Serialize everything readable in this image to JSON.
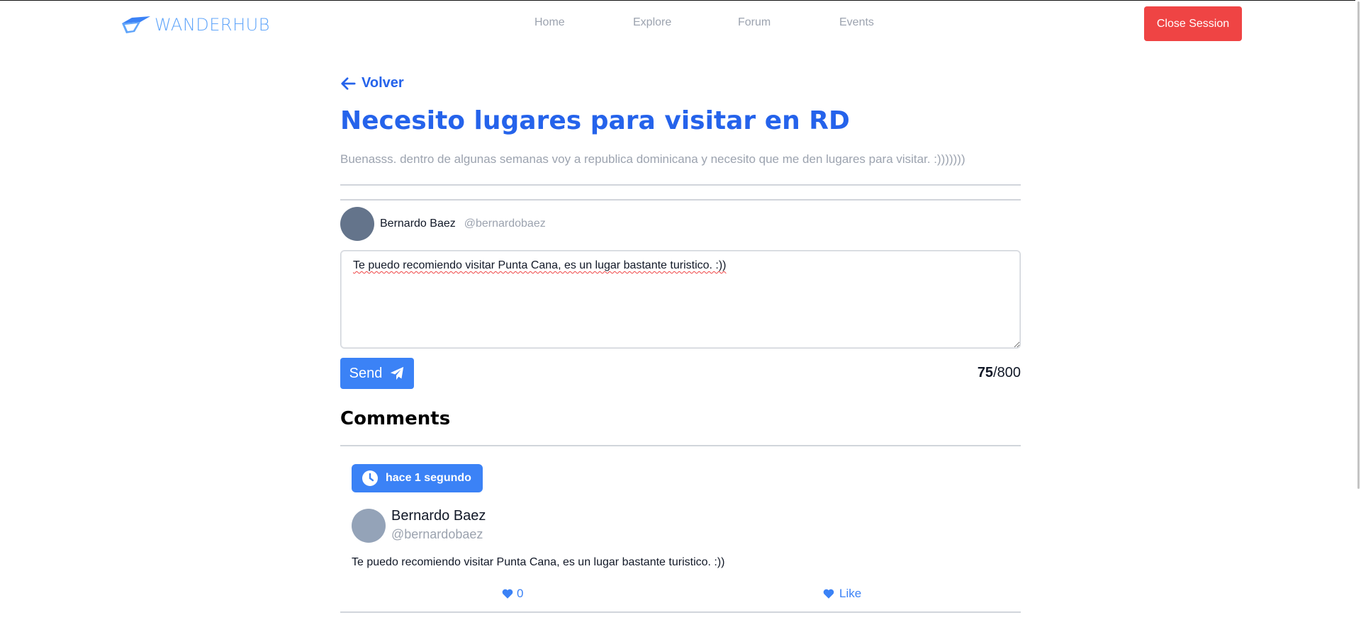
{
  "brand": {
    "name": "WANDERHUB"
  },
  "nav": {
    "items": [
      {
        "label": "Home"
      },
      {
        "label": "Explore"
      },
      {
        "label": "Forum"
      },
      {
        "label": "Events"
      }
    ],
    "close_session_label": "Close Session"
  },
  "post": {
    "back_label": "Volver",
    "title": "Necesito lugares para visitar en RD",
    "body": "Buenasss. dentro de algunas semanas voy a republica dominicana y necesito que me den lugares para visitar. :)))))))"
  },
  "composer": {
    "user_name": "Bernardo Baez",
    "user_handle": "@bernardobaez",
    "text": "Te puedo recomiendo visitar Punta Cana, es un lugar bastante turistico. :))",
    "send_label": "Send",
    "char_count": "75",
    "char_limit": "/800"
  },
  "comments": {
    "heading": "Comments",
    "items": [
      {
        "time": "hace 1 segundo",
        "user_name": "Bernardo Baez",
        "user_handle": "@bernardobaez",
        "text": "Te puedo recomiendo visitar Punta Cana, es un lugar bastante turistico. :))",
        "likes": "0",
        "like_label": "Like"
      }
    ]
  },
  "colors": {
    "primary": "#2563eb",
    "accent": "#3b82f6",
    "danger": "#ef4444",
    "muted": "#9ca3af"
  }
}
